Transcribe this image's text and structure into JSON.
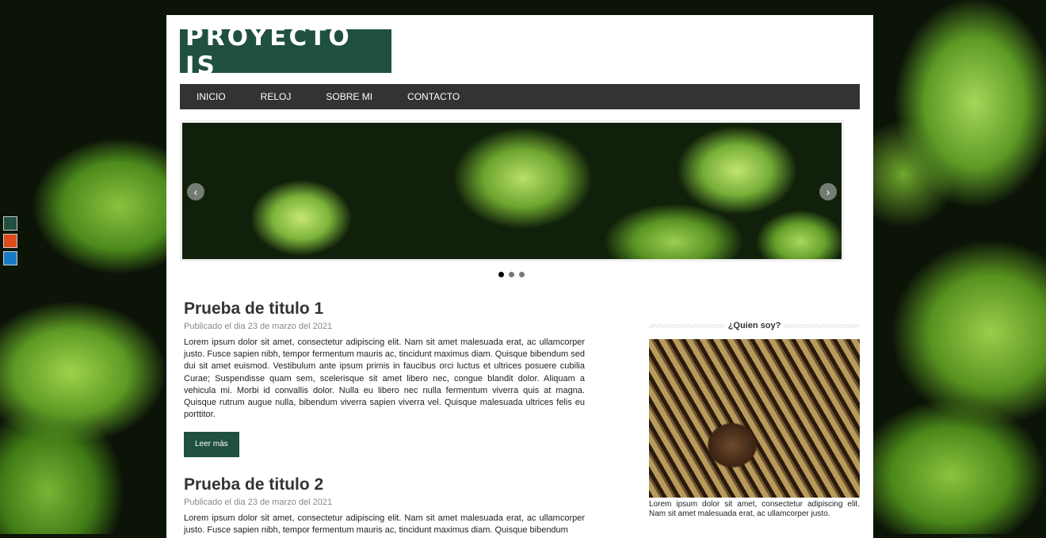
{
  "colors": {
    "brand": "#1f5040",
    "nav_bg": "#333333"
  },
  "theme_swatches": [
    "#1f5040",
    "#dd4b1a",
    "#1a7bc4"
  ],
  "logo": "PROYECTO JS",
  "nav": [
    "INICIO",
    "RELOJ",
    "SOBRE MI",
    "CONTACTO"
  ],
  "slider": {
    "prev": "‹",
    "next": "›",
    "slides": 3,
    "active": 0
  },
  "posts": [
    {
      "title": "Prueba de titulo 1",
      "meta": "Publicado el dia 23 de marzo del 2021",
      "body": "Lorem ipsum dolor sit amet, consectetur adipiscing elit. Nam sit amet malesuada erat, ac ullamcorper justo. Fusce sapien nibh, tempor fermentum mauris ac, tincidunt maximus diam. Quisque bibendum sed dui sit amet euismod. Vestibulum ante ipsum primis in faucibus orci luctus et ultrices posuere cubilia Curae; Suspendisse quam sem, scelerisque sit amet libero nec, congue blandit dolor. Aliquam a vehicula mi. Morbi id convallis dolor. Nulla eu libero nec nulla fermentum viverra quis at magna. Quisque rutrum augue nulla, bibendum viverra sapien viverra vel. Quisque malesuada ultrices felis eu porttitor.",
      "button": "Leer más"
    },
    {
      "title": "Prueba de titulo 2",
      "meta": "Publicado el dia 23 de marzo del 2021",
      "body": "Lorem ipsum dolor sit amet, consectetur adipiscing elit. Nam sit amet malesuada erat, ac ullamcorper justo. Fusce sapien nibh, tempor fermentum mauris ac, tincidunt maximus diam. Quisque bibendum"
    }
  ],
  "sidebar": {
    "title": "¿Quien soy?",
    "caption": "Lorem ipsum dolor sit amet, consectetur adipiscing elit. Nam sit amet malesuada erat, ac ullamcorper justo."
  }
}
